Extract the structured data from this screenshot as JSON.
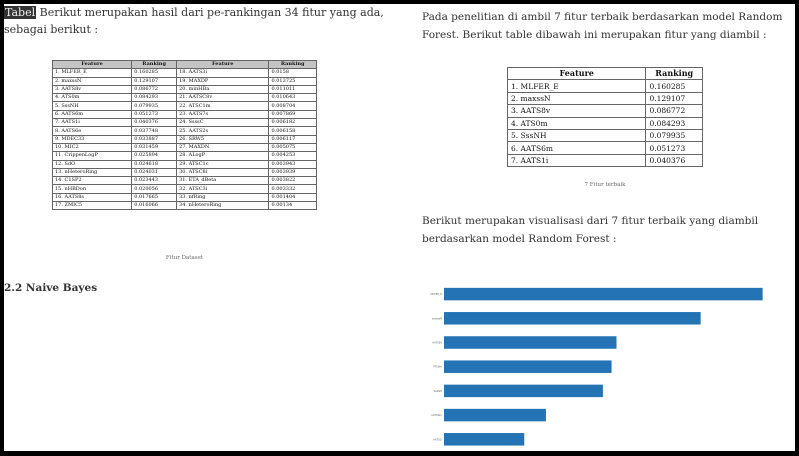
{
  "left": {
    "intro_marker": "Tabel",
    "intro": " Berikut merupakan hasil dari pe-rankingan 34 fitur yang ada, sebagai berikut :",
    "table_headers": [
      "Feature",
      "Ranking",
      "Feature",
      "Ranking"
    ],
    "table_rows": [
      [
        "1. MLFER_E",
        "0.160285",
        "18. AATS3i",
        "0.0158"
      ],
      [
        "2. maxssN",
        "0.129107",
        "19. MAXDP",
        "0.013725"
      ],
      [
        "3. AATS8v",
        "0.086772",
        "20. minHBa",
        "0.011011"
      ],
      [
        "4. ATS0m",
        "0.084293",
        "21. AATSC8v",
        "0.010643"
      ],
      [
        "5. SssNH",
        "0.079935",
        "22. ATSC1m",
        "0.008704"
      ],
      [
        "6. AATS6m",
        "0.051273",
        "23. AATS7s",
        "0.007869"
      ],
      [
        "7. AATS1i",
        "0.040376",
        "24. SsssC",
        "0.006182"
      ],
      [
        "8. AATS6e",
        "0.037748",
        "25. AATS2s",
        "0.006158"
      ],
      [
        "9. MDEC33",
        "0.033887",
        "26. SRW5",
        "0.006117"
      ],
      [
        "10. MIC2",
        "0.031459",
        "27. MAXDN",
        "0.005075"
      ],
      [
        "11. CrippenLogP",
        "0.025894",
        "28. ALogP",
        "0.004253"
      ],
      [
        "12. SdO",
        "0.024618",
        "29. ATSC1c",
        "0.003943"
      ],
      [
        "13. nHeteroRing",
        "0.024031",
        "30. ATSC8i",
        "0.003939"
      ],
      [
        "14. C1SP2",
        "0.023443",
        "31. ETA_dBeta",
        "0.003822"
      ],
      [
        "15. nHBDon",
        "0.020056",
        "32. ATSC3i",
        "0.003332"
      ],
      [
        "16. AATS8s",
        "0.017665",
        "33. nfRing",
        "0.001404"
      ],
      [
        "17. ZMIC5",
        "0.016066",
        "34. nHeteroRing",
        "0.00134"
      ]
    ],
    "table_caption": "Fitur Dataset",
    "section_heading": "2.2 Naive Bayes"
  },
  "right": {
    "intro": "Pada penelitian di ambil 7 fitur terbaik berdasarkan model Random Forest. Berikut table dibawah ini merupakan fitur yang diambil :",
    "table_headers": [
      "Feature",
      "Ranking"
    ],
    "table_rows": [
      [
        "1. MLFER_E",
        "0.160285"
      ],
      [
        "2. maxssN",
        "0.129107"
      ],
      [
        "3. AATS8v",
        "0.086772"
      ],
      [
        "4. ATS0m",
        "0.084293"
      ],
      [
        "5. SssNH",
        "0.079935"
      ],
      [
        "6. AATS6m",
        "0.051273"
      ],
      [
        "7. AATS1i",
        "0.040376"
      ]
    ],
    "table_caption": "7 Fitur terbaik",
    "viz_text": "Berikut merupakan visualisasi dari 7 fitur terbaik yang diambil berdasarkan model Random Forest :"
  },
  "chart_data": {
    "type": "bar",
    "orientation": "horizontal",
    "categories": [
      "AATS1i",
      "AATS6m",
      "SssNH",
      "ATS0m",
      "AATS8v",
      "maxssN",
      "MLFER_E"
    ],
    "values": [
      0.040376,
      0.051273,
      0.079935,
      0.084293,
      0.086772,
      0.129107,
      0.160285
    ],
    "xlim": [
      0,
      0.165
    ],
    "x_ticks": [
      "0.00",
      "0.02",
      "0.04",
      "0.06",
      "0.08",
      "0.10",
      "0.12",
      "0.14",
      "0.16"
    ],
    "title": "",
    "xlabel": "",
    "ylabel": "",
    "color": "#2474b5",
    "grid": false
  }
}
